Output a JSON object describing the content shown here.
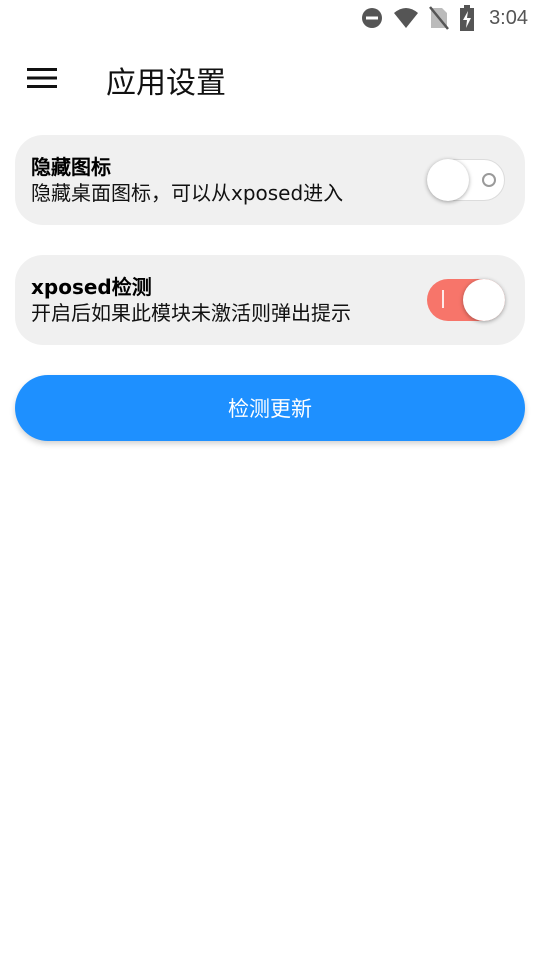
{
  "status_bar": {
    "time": "3:04",
    "icons": [
      "do-not-disturb-icon",
      "wifi-icon",
      "no-sim-icon",
      "battery-charging-icon"
    ]
  },
  "toolbar": {
    "menu_icon": "menu-icon",
    "title": "应用设置"
  },
  "settings": [
    {
      "title": "隐藏图标",
      "description": "隐藏桌面图标，可以从xposed进入",
      "enabled": false
    },
    {
      "title": "xposed检测",
      "description": "开启后如果此模块未激活则弹出提示",
      "enabled": true
    }
  ],
  "check_update_button": {
    "label": "检测更新"
  },
  "colors": {
    "accent_blue": "#1e90ff",
    "switch_on": "#f7756a",
    "card_bg": "#f0f0f0"
  }
}
